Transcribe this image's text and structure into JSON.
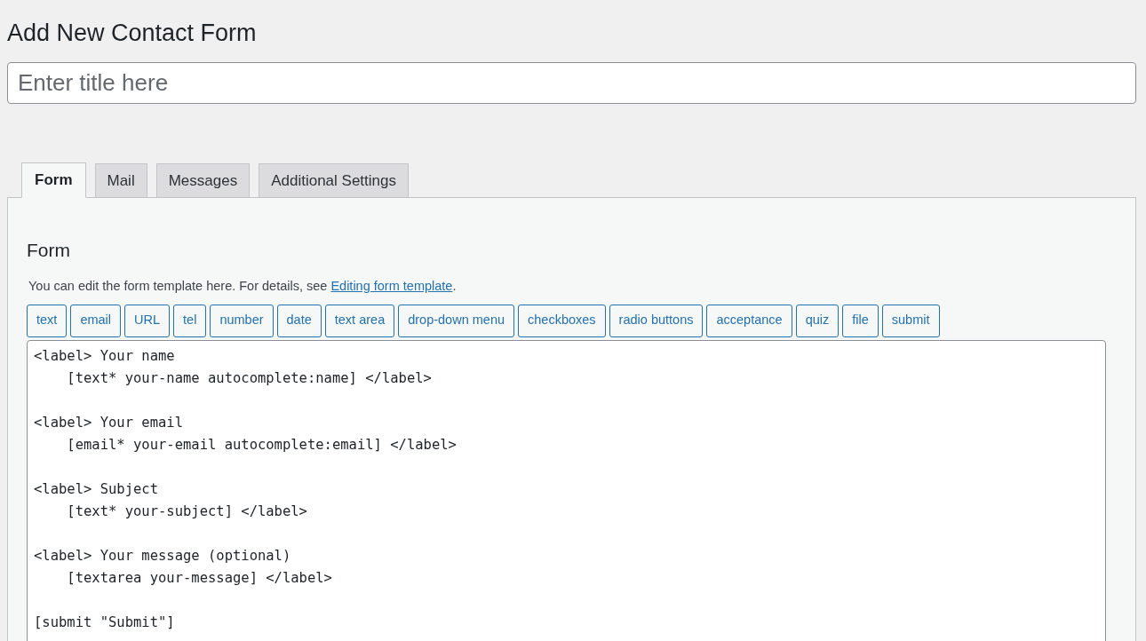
{
  "page_title": "Add New Contact Form",
  "title_field": {
    "placeholder": "Enter title here"
  },
  "tabs": [
    {
      "label": "Form",
      "selected": true
    },
    {
      "label": "Mail",
      "selected": false
    },
    {
      "label": "Messages",
      "selected": false
    },
    {
      "label": "Additional Settings",
      "selected": false
    }
  ],
  "panel": {
    "heading": "Form",
    "description": "You can edit the form template here. For details, see ",
    "link": "Editing form template",
    "description_end": ".",
    "tag_buttons": [
      "text",
      "email",
      "URL",
      "tel",
      "number",
      "date",
      "text area",
      "drop-down menu",
      "checkboxes",
      "radio buttons",
      "acceptance",
      "quiz",
      "file",
      "submit"
    ],
    "template_blocks": [
      [
        "<label> Your name",
        "    [text* your-name autocomplete:name] </label>"
      ],
      [
        "<label> Your email",
        "    [email* your-email autocomplete:email] </label>"
      ],
      [
        "<label> Subject",
        "    [text* your-subject] </label>"
      ],
      [
        "<label> Your message (optional)",
        "    [textarea your-message] </label>"
      ],
      [
        "[submit \"Submit\"]"
      ]
    ]
  }
}
